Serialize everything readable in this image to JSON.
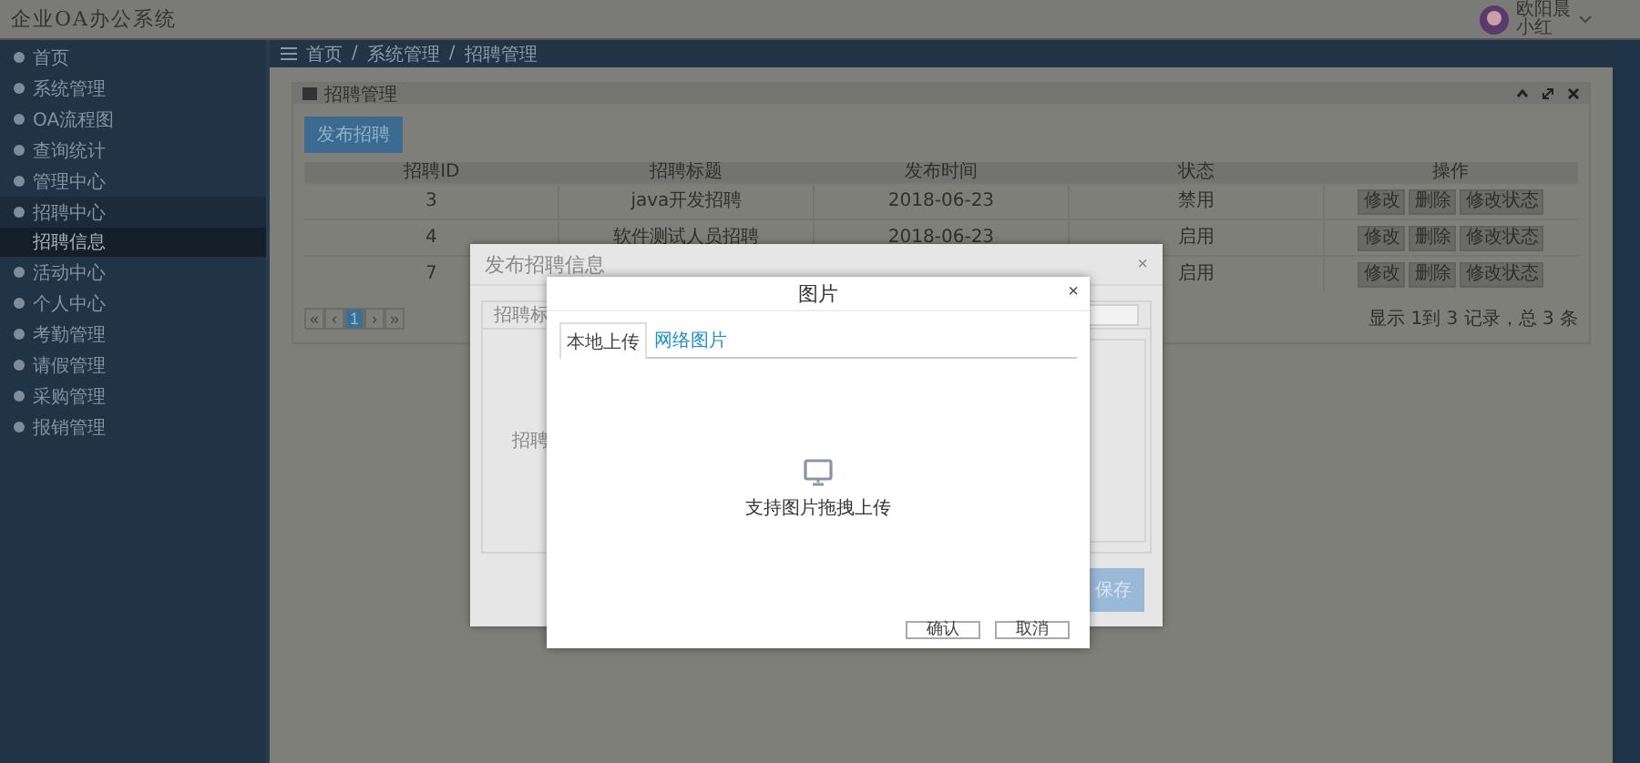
{
  "header": {
    "title": "企业OA办公系统",
    "user": {
      "name": "欧阳晨",
      "role": "小红"
    }
  },
  "sidebar": {
    "items": [
      {
        "label": "首页",
        "selected": false
      },
      {
        "label": "系统管理",
        "selected": false
      },
      {
        "label": "OA流程图",
        "selected": false
      },
      {
        "label": "查询统计",
        "selected": false
      },
      {
        "label": "管理中心",
        "selected": false
      },
      {
        "label": "招聘中心",
        "selected": true,
        "expanded": true,
        "children": [
          {
            "label": "招聘信息",
            "selected": true
          }
        ]
      },
      {
        "label": "活动中心",
        "selected": false
      },
      {
        "label": "个人中心",
        "selected": false
      },
      {
        "label": "考勤管理",
        "selected": false
      },
      {
        "label": "请假管理",
        "selected": false
      },
      {
        "label": "采购管理",
        "selected": false
      },
      {
        "label": "报销管理",
        "selected": false
      }
    ]
  },
  "breadcrumb": {
    "separator": "/",
    "items": [
      "首页",
      "系统管理",
      "招聘管理"
    ]
  },
  "panel": {
    "title": "招聘管理",
    "publish_button": "发布招聘",
    "table": {
      "columns": [
        "招聘ID",
        "招聘标题",
        "发布时间",
        "状态",
        "操作"
      ],
      "rows": [
        {
          "id": "3",
          "title": "java开发招聘",
          "date": "2018-06-23",
          "status": "禁用",
          "actions": [
            "修改",
            "删除",
            "修改状态"
          ]
        },
        {
          "id": "4",
          "title": "软件测试人员招聘",
          "date": "2018-06-23",
          "status": "启用",
          "actions": [
            "修改",
            "删除",
            "修改状态"
          ]
        },
        {
          "id": "7",
          "status": "启用",
          "actions": [
            "修改",
            "删除",
            "修改状态"
          ]
        }
      ]
    },
    "pagination": {
      "pages": [
        {
          "label": "«",
          "selected": false
        },
        {
          "label": "‹",
          "selected": false
        },
        {
          "label": "1",
          "selected": true
        },
        {
          "label": "›",
          "selected": false
        },
        {
          "label": "»",
          "selected": false
        }
      ],
      "summary": "显示 1到 3 记录，总 3 条"
    }
  },
  "dialog": {
    "title": "发布招聘信息",
    "close": "×",
    "fields": [
      {
        "label": "招聘标"
      },
      {
        "label": "招聘"
      }
    ],
    "save_button": "保存"
  },
  "image_dialog": {
    "title": "图片",
    "close": "×",
    "tabs": [
      {
        "label": "本地上传",
        "selected": true
      },
      {
        "label": "网络图片",
        "selected": false
      }
    ],
    "drop_hint": "支持图片拖拽上传",
    "buttons": [
      "确认",
      "取消"
    ]
  }
}
